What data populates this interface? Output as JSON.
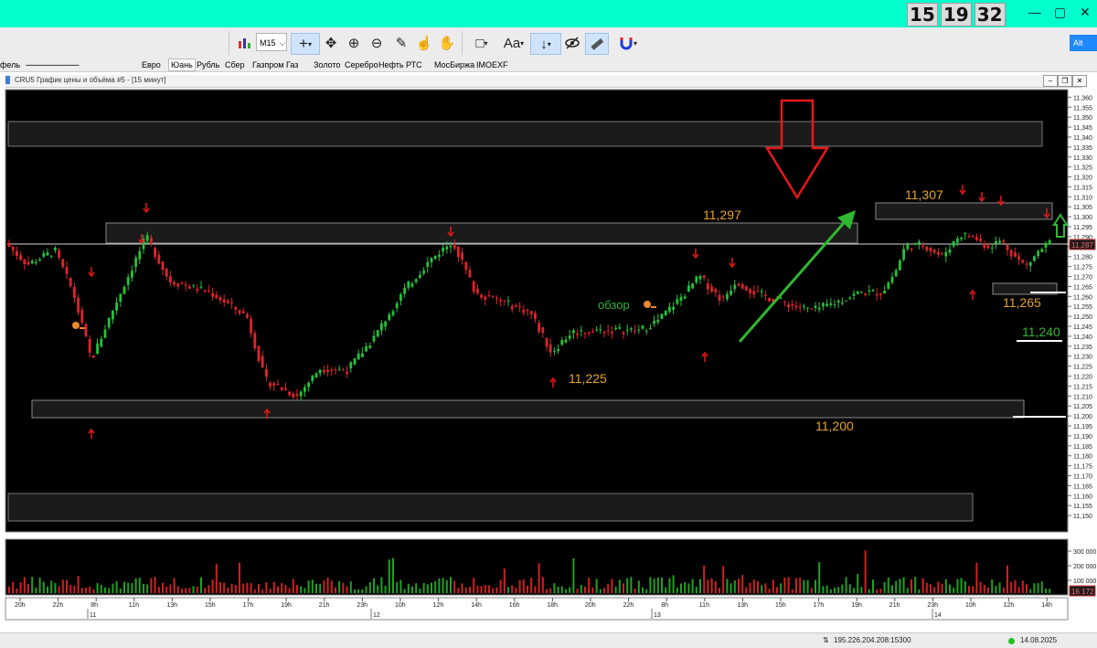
{
  "clock": {
    "hours": "15",
    "minutes": "19",
    "seconds": "32"
  },
  "toolbar": {
    "timeframe": "M15",
    "text_tool": "Aa",
    "search_label": "Alt"
  },
  "quickbar": [
    "фель",
    "-----------------------------",
    "Евро",
    "Юань",
    "Рубль",
    "Сбер",
    "Газпром",
    "Газ",
    "Золото",
    "Серебро",
    "Нефть",
    "РТС",
    "МосБиржа",
    "IMOEXF"
  ],
  "window": {
    "title": "CRU5 График цены и объёма #5 - [15 минут]"
  },
  "status": {
    "server": "195.226.204.208:15300",
    "date": "14.08.2025"
  },
  "chart_data": {
    "type": "candlestick",
    "instrument": "CRU5",
    "timeframe": "15 минут",
    "ylim": [
      11.145,
      11.362
    ],
    "y_ticks": [
      "11,360",
      "11,355",
      "11,350",
      "11,345",
      "11,340",
      "11,335",
      "11,330",
      "11,325",
      "11,320",
      "11,315",
      "11,310",
      "11,305",
      "11,300",
      "11,295",
      "11,290",
      "11,285",
      "11,280",
      "11,275",
      "11,270",
      "11,265",
      "11,260",
      "11,255",
      "11,250",
      "11,245",
      "11,240",
      "11,235",
      "11,230",
      "11,225",
      "11,220",
      "11,215",
      "11,210",
      "11,205",
      "11,200",
      "11,195",
      "11,190",
      "11,185",
      "11,180",
      "11,175",
      "11,170",
      "11,165",
      "11,160",
      "11,155",
      "11,150"
    ],
    "current_price": "11,287",
    "volume_ticks": [
      "300 000",
      "200 000",
      "100 000"
    ],
    "current_volume": "16 172",
    "x_ticks": [
      "20h",
      "22h",
      "8h",
      "11h",
      "13h",
      "15h",
      "17h",
      "19h",
      "21h",
      "23h",
      "10h",
      "12h",
      "14h",
      "16h",
      "18h",
      "20h",
      "22h",
      "8h",
      "11h",
      "13h",
      "15h",
      "17h",
      "19h",
      "21h",
      "23h",
      "10h",
      "12h",
      "14h"
    ],
    "date_labels": [
      "11",
      "12",
      "13",
      "14"
    ],
    "price_labels": [
      "11,297",
      "11,307",
      "11,265",
      "11,240",
      "11,225",
      "11,200"
    ],
    "review_label": "обзор",
    "volume_colors": {
      "up": "#1fa31f",
      "down": "#d0221f"
    },
    "colors": {
      "bull": "#23c23a",
      "bear": "#e0232a",
      "annotation": "#e6a22c",
      "arrow_red": "#e81818",
      "arrow_green": "#2fb82f"
    }
  }
}
